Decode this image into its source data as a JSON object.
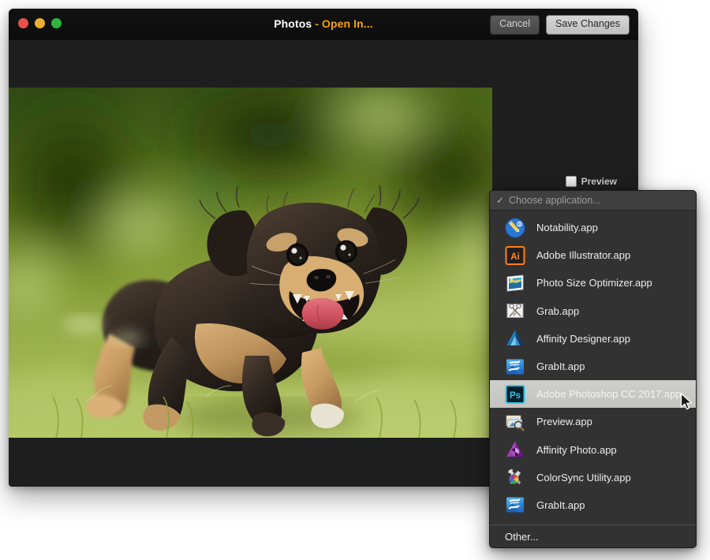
{
  "window": {
    "title_main": "Photos",
    "title_sub": " - Open In...",
    "traffic_lights": [
      {
        "name": "close",
        "color": "#e8504a"
      },
      {
        "name": "minimize",
        "color": "#efae2f"
      },
      {
        "name": "zoom",
        "color": "#2cb63f"
      }
    ],
    "buttons": {
      "cancel": "Cancel",
      "save": "Save Changes"
    },
    "preview": {
      "label": "Preview",
      "checked": false
    },
    "photo_alt": "Running puppy on grass"
  },
  "menu": {
    "header_label": "Choose application...",
    "header_checkmark": "✓",
    "footer_label": "Other...",
    "selected_index": 6,
    "items": [
      {
        "label": "Notability.app",
        "icon": "notability-icon"
      },
      {
        "label": "Adobe Illustrator.app",
        "icon": "adobe-illustrator-icon"
      },
      {
        "label": "Photo Size Optimizer.app",
        "icon": "photo-size-optimizer-icon"
      },
      {
        "label": "Grab.app",
        "icon": "grab-icon"
      },
      {
        "label": "Affinity Designer.app",
        "icon": "affinity-designer-icon"
      },
      {
        "label": "GrabIt.app",
        "icon": "grabit-icon"
      },
      {
        "label": "Adobe Photoshop CC 2017.app",
        "icon": "adobe-photoshop-icon"
      },
      {
        "label": "Preview.app",
        "icon": "preview-icon"
      },
      {
        "label": "Affinity Photo.app",
        "icon": "affinity-photo-icon"
      },
      {
        "label": "ColorSync Utility.app",
        "icon": "colorsync-utility-icon"
      },
      {
        "label": "GrabIt.app",
        "icon": "grabit-icon"
      }
    ]
  },
  "colors": {
    "accent_title": "#f3a307",
    "window_bg": "#1e1e1e",
    "titlebar_bg": "#111111",
    "menu_bg": "#323232",
    "menu_header_bg": "#3f3f3f",
    "menu_selected_bg": "#cfcfcb",
    "page_bg": "#ffffff"
  }
}
